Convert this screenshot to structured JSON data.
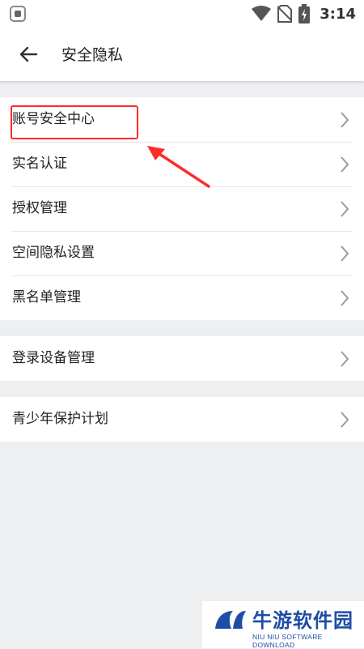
{
  "status_bar": {
    "time": "3:14",
    "icons": [
      "app-icon",
      "wifi-icon",
      "sim-off-icon",
      "battery-charging-icon"
    ]
  },
  "header": {
    "title": "安全隐私",
    "back_icon": "arrow-left-icon"
  },
  "groups": [
    {
      "items": [
        {
          "label": "账号安全中心"
        },
        {
          "label": "实名认证"
        },
        {
          "label": "授权管理"
        },
        {
          "label": "空间隐私设置"
        },
        {
          "label": "黑名单管理"
        }
      ]
    },
    {
      "items": [
        {
          "label": "登录设备管理"
        }
      ]
    },
    {
      "items": [
        {
          "label": "青少年保护计划"
        }
      ]
    }
  ],
  "annotation": {
    "highlight_color": "#ff2a2a"
  },
  "watermark": {
    "title": "牛游软件园",
    "subtitle": "NIU NIU SOFTWARE DOWNLOAD",
    "color": "#1e4da5"
  }
}
